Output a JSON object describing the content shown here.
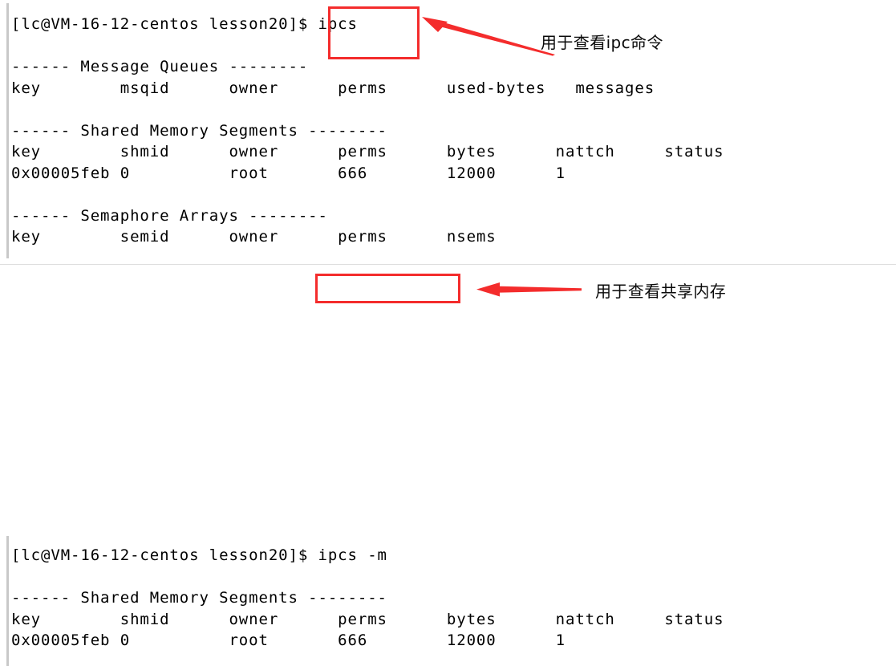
{
  "terminal": {
    "blocks": [
      {
        "id": "top",
        "text": "[lc@VM-16-12-centos lesson20]$ ipcs\n\n------ Message Queues --------\nkey        msqid      owner      perms      used-bytes   messages\n\n------ Shared Memory Segments --------\nkey        shmid      owner      perms      bytes      nattch     status\n0x00005feb 0          root       666        12000      1\n\n------ Semaphore Arrays --------\nkey        semid      owner      perms      nsems"
      },
      {
        "id": "bottom",
        "text": "[lc@VM-16-12-centos lesson20]$ ipcs -m\n\n------ Shared Memory Segments --------\nkey        shmid      owner      perms      bytes      nattch     status\n0x00005feb 0          root       666        12000      1"
      }
    ],
    "prompt": "[lc@VM-16-12-centos lesson20]$",
    "user": "lc",
    "host": "VM-16-12-centos",
    "cwd": "lesson20",
    "commands": [
      "ipcs",
      "ipcs -m"
    ],
    "sections": [
      {
        "title": "------ Message Queues --------",
        "name": "Message Queues",
        "headers": [
          "key",
          "msqid",
          "owner",
          "perms",
          "used-bytes",
          "messages"
        ],
        "rows": []
      },
      {
        "title": "------ Shared Memory Segments --------",
        "name": "Shared Memory Segments",
        "headers": [
          "key",
          "shmid",
          "owner",
          "perms",
          "bytes",
          "nattch",
          "status"
        ],
        "rows": [
          [
            "0x00005feb",
            "0",
            "root",
            "666",
            "12000",
            "1",
            ""
          ]
        ]
      },
      {
        "title": "------ Semaphore Arrays --------",
        "name": "Semaphore Arrays",
        "headers": [
          "key",
          "semid",
          "owner",
          "perms",
          "nsems"
        ],
        "rows": []
      }
    ]
  },
  "annotations": [
    {
      "id": "annotation-ipcs",
      "caption": "用于查看ipc命令",
      "target_text": "ipcs",
      "arrow": "arrow-left-up",
      "color": "#f42c2c"
    },
    {
      "id": "annotation-ipcs-m",
      "caption": "用于查看共享内存",
      "target_text": "ipcs -m",
      "arrow": "arrow-left",
      "color": "#f42c2c"
    }
  ],
  "colors": {
    "accent_red": "#f42c2c",
    "text": "#000000",
    "background": "#ffffff",
    "rail": "#c9c9c9",
    "divider": "#dedede"
  }
}
